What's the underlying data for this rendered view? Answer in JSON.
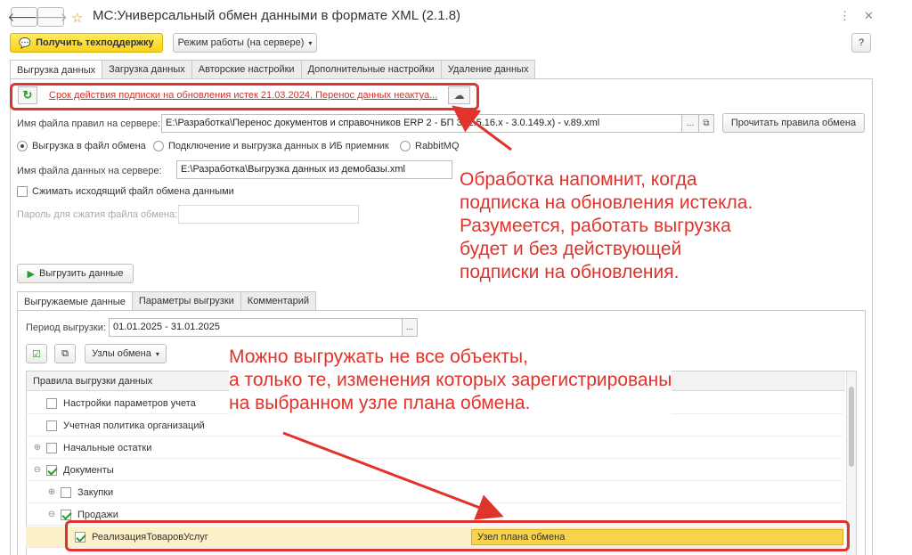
{
  "window": {
    "title": "МС:Универсальный обмен данными в формате XML (2.1.8)",
    "back_icon": "arrow-left-icon",
    "forward_icon": "arrow-right-icon",
    "more_label": "⋮",
    "link_label": "🔗",
    "restore_label": "▢",
    "close_label": "✕"
  },
  "toolbar": {
    "support_label": "Получить техподдержку",
    "mode_label": "Режим работы (на сервере)",
    "help_label": "?"
  },
  "main_tabs": [
    "Выгрузка данных",
    "Загрузка данных",
    "Авторские настройки",
    "Дополнительные настройки",
    "Удаление данных"
  ],
  "subscription": {
    "warning_text": "Срок действия подписки на обновления истек 21.03.2024. Перенос данных неактуа..."
  },
  "rules_file": {
    "label": "Имя файла правил на сервере:",
    "value": "E:\\Разработка\\Перенос документов и справочников ERP 2 - БП 3 (2.5.16.x - 3.0.149.x) - v.89.xml",
    "read_button": "Прочитать правила обмена"
  },
  "export_mode": {
    "options": [
      "Выгрузка в файл обмена",
      "Подключение и выгрузка данных в ИБ приемник",
      "RabbitMQ"
    ],
    "selected": 0
  },
  "data_file": {
    "label": "Имя файла данных на сервере:",
    "value": "E:\\Разработка\\Выгрузка данных из демобазы.xml"
  },
  "compress": {
    "label": "Сжимать исходящий файл обмена данными",
    "checked": false
  },
  "password": {
    "label": "Пароль для сжатия файла обмена:",
    "value": ""
  },
  "export_button": "Выгрузить данные",
  "sub_tabs": [
    "Выгружаемые данные",
    "Параметры выгрузки",
    "Комментарий"
  ],
  "period": {
    "label": "Период выгрузки:",
    "value": "01.01.2025 - 31.01.2025"
  },
  "nodes_button": "Узлы обмена",
  "table": {
    "header": "Правила выгрузки данных",
    "rows": [
      {
        "label": "Настройки параметров учета",
        "level": 0,
        "expander": "",
        "checked": false,
        "node": ""
      },
      {
        "label": "Учетная политика организаций",
        "level": 0,
        "expander": "",
        "checked": false,
        "node": ""
      },
      {
        "label": "Начальные остатки",
        "level": 0,
        "expander": "⊕",
        "checked": false,
        "node": ""
      },
      {
        "label": "Документы",
        "level": 0,
        "expander": "⊖",
        "checked": true,
        "node": ""
      },
      {
        "label": "Закупки",
        "level": 1,
        "expander": "⊕",
        "checked": false,
        "node": ""
      },
      {
        "label": "Продажи",
        "level": 1,
        "expander": "⊖",
        "checked": true,
        "node": ""
      },
      {
        "label": "РеализацияТоваровУслуг",
        "level": 2,
        "expander": "",
        "checked": true,
        "node": "Узел плана обмена"
      }
    ]
  },
  "annotations": {
    "top": [
      "Обработка напомнит, когда",
      "подписка на обновления истекла.",
      "Разумеется, работать выгрузка",
      "будет и без действующей",
      "подписки на обновления."
    ],
    "bottom": [
      "Можно выгружать не все объекты,",
      "а только те, изменения которых зарегистрированы",
      "на выбранном узле плана обмена."
    ]
  },
  "colors": {
    "annotation_red": "#e0332b",
    "link_red": "#d0312d",
    "highlight_row": "#fbf0c7",
    "node_cell": "#f7d24b"
  }
}
